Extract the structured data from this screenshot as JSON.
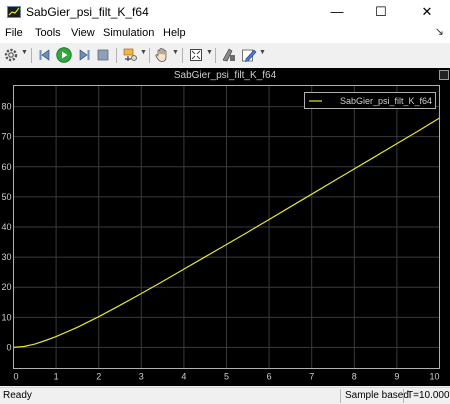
{
  "window": {
    "title": "SabGier_psi_filt_K_f64",
    "controls": {
      "minimize": "—",
      "maximize": "☐",
      "close": "✕"
    }
  },
  "menu": {
    "items": [
      {
        "label": "File"
      },
      {
        "label": "Tools"
      },
      {
        "label": "View"
      },
      {
        "label": "Simulation"
      },
      {
        "label": "Help"
      }
    ],
    "overflow_arrow": "↘"
  },
  "toolbar": {
    "icons": [
      "gear-icon",
      "step-back-icon",
      "run-icon",
      "step-forward-icon",
      "stop-icon",
      "highlight-icon",
      "pan-icon",
      "zoom-icon",
      "fit-icon",
      "style-icon",
      "edit-icon"
    ]
  },
  "plot": {
    "title": "SabGier_psi_filt_K_f64",
    "colors": {
      "background": "#000000",
      "axes": "#b0b0b0",
      "grid": "#3a3a3a",
      "line": "#e6e62e",
      "text": "#cfcfcf"
    }
  },
  "chart_data": {
    "type": "line",
    "title": "SabGier_psi_filt_K_f64",
    "xlabel": "",
    "ylabel": "",
    "xlim": [
      0,
      10
    ],
    "ylim": [
      -7,
      87
    ],
    "xticks": [
      0,
      1,
      2,
      3,
      4,
      5,
      6,
      7,
      8,
      9,
      10
    ],
    "yticks": [
      0,
      10,
      20,
      30,
      40,
      50,
      60,
      70,
      80
    ],
    "grid": true,
    "legend_position": "top-right",
    "series": [
      {
        "name": "SabGier_psi_filt_K_f64",
        "x": [
          0,
          0.25,
          0.5,
          0.75,
          1,
          1.5,
          2,
          2.5,
          3,
          3.5,
          4,
          4.5,
          5,
          5.5,
          6,
          6.5,
          7,
          7.5,
          8,
          8.5,
          9,
          9.5,
          10
        ],
        "y": [
          0,
          0.3,
          1.1,
          2.3,
          3.6,
          6.7,
          10.2,
          14.0,
          17.9,
          21.9,
          26.0,
          30.1,
          34.2,
          38.3,
          42.5,
          46.7,
          50.9,
          55.1,
          59.3,
          63.5,
          67.7,
          71.9,
          76.2
        ]
      }
    ]
  },
  "status": {
    "ready": "Ready",
    "mode": "Sample based",
    "time": "T=10.000"
  }
}
